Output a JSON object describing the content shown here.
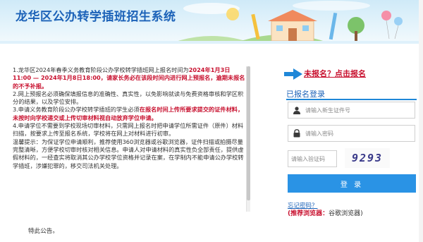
{
  "header": {
    "title": "龙华区公办转学插班招生系统"
  },
  "notice": {
    "p1_a": "1.龙华区2024年春季义务教育阶段公办学校转学插班网上报名时间为",
    "p1_red": "2024年1月3日11:00 — 2024年1月8日18:00，请家长务必在该段时间内进行网上预报名，逾期未报名的不予补报。",
    "p2": "2.网上预报名必须确保填报信息的准确性、真实性，以免影响就读与免费资格审核和学区积分的结果，以及学位安排。",
    "p3_a": "3.申请义务教育阶段公办学校转学插班的学生必须",
    "p3_red": "在报名时间上传所要求提交的证件材料，未按时向学校递交或上传切审材料视自动放弃学位申请。",
    "p4": "4.申请学位不需要到学校现场切审材料，只需网上报名时把申请学位所需证件（原件）材料扫描，按要求上传至报名系统，学校将在网上对材料进行初审。",
    "p5": "温馨提示：为保证学位申请顺利，推荐使用360浏览器或谷歌浏览器，证件扫描或拍摄尽量完整清晰，方便学校切审时核对相关信息。申请人对申请材料的真实性负全部责任，提供虚假材料的，一经查实将取消其公办学校学位资格并记录在案，在学制内不能申请公办学校转学插班，涉嫌犯罪的，移交司法机关处理。",
    "closing": "特此公告。"
  },
  "login": {
    "unregistered_link": "未报名？点击报名",
    "title": "已报名登录",
    "id_placeholder": "请输入新生证件号",
    "password_placeholder": "请输入密码",
    "captcha_placeholder": "请输入验证码",
    "captcha_code": "9293",
    "login_button": "登 录",
    "forgot_password": "忘记密码？",
    "recommend_label": "(推荐浏览器：",
    "recommend_value": "谷歌浏览器)"
  },
  "colors": {
    "brand_blue": "#1c62b8",
    "button_blue": "#2a93e5",
    "alert_red": "#c8102e"
  },
  "icons": {
    "user": "user-icon",
    "lock": "lock-icon",
    "arrow": "arrow-right-icon"
  }
}
